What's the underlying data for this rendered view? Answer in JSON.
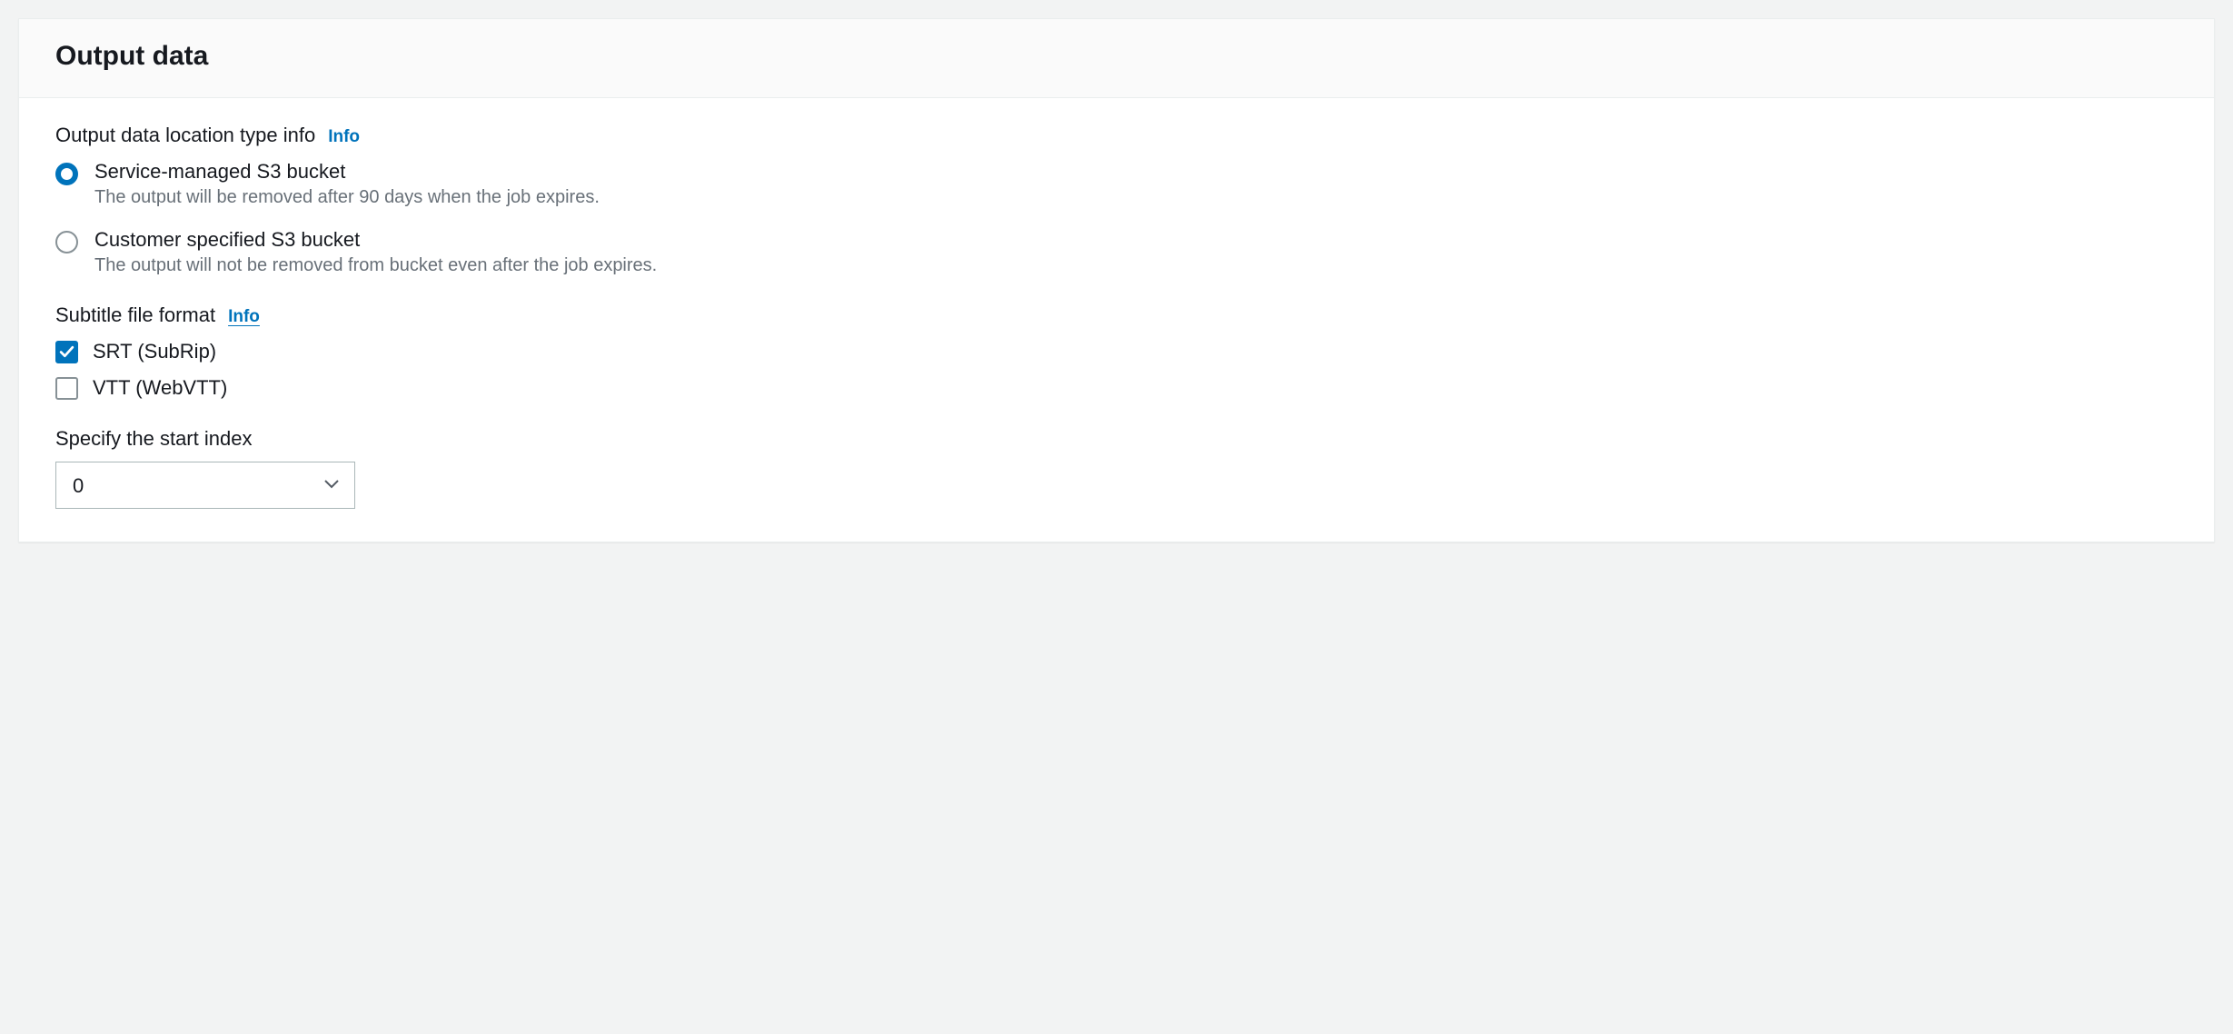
{
  "panel": {
    "title": "Output data"
  },
  "outputDataSection": {
    "label": "Output data location type info",
    "infoLabel": "Info",
    "options": [
      {
        "label": "Service-managed S3 bucket",
        "description": "The output will be removed after 90 days when the job expires.",
        "selected": true
      },
      {
        "label": "Customer specified S3 bucket",
        "description": "The output will not be removed from bucket even after the job expires.",
        "selected": false
      }
    ]
  },
  "subtitleSection": {
    "label": "Subtitle file format",
    "infoLabel": "Info",
    "options": [
      {
        "label": "SRT (SubRip)",
        "checked": true
      },
      {
        "label": "VTT (WebVTT)",
        "checked": false
      }
    ]
  },
  "startIndexSection": {
    "label": "Specify the start index",
    "value": "0"
  }
}
